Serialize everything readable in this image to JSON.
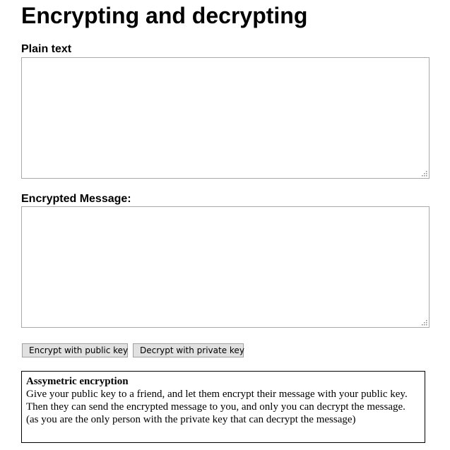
{
  "page": {
    "title": "Encrypting and decrypting"
  },
  "plain": {
    "label": "Plain text",
    "value": ""
  },
  "encrypted": {
    "label": "Encrypted Message:",
    "value": ""
  },
  "buttons": {
    "encrypt_label": "Encrypt with public key",
    "decrypt_label": "Decrypt with private key"
  },
  "info": {
    "title": "Assymetric encryption",
    "text": "Give your public key to a friend, and let them encrypt their message with your public key. Then they can send the encrypted message to you, and only you can decrypt the message. (as you are the only person with the private key that can decrypt the message)"
  },
  "icons": {
    "resize_grip": "resize-grip-icon"
  }
}
